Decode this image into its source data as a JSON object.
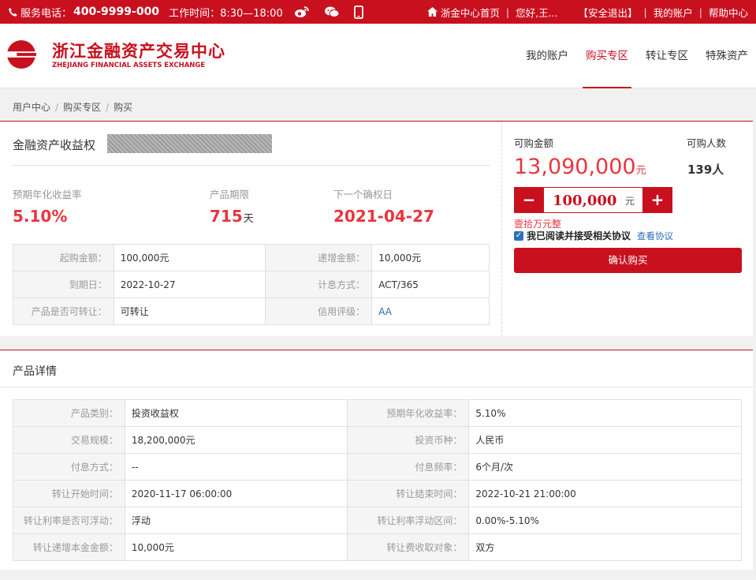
{
  "topbar": {
    "phone_label": "服务电话：",
    "phone_number": "400-9999-000",
    "hours": "工作时间：8:30—18:00",
    "home_link": "浙金中心首页",
    "greeting": "您好,王...",
    "logout": "【安全退出】",
    "my_account": "我的账户",
    "help": "帮助中心"
  },
  "header": {
    "logo_cn": "浙江金融资产交易中心",
    "logo_en": "ZHEJIANG FINANCIAL ASSETS EXCHANGE",
    "nav": [
      "我的账户",
      "购买专区",
      "转让专区",
      "特殊资产"
    ],
    "active_nav": "购买专区"
  },
  "breadcrumb": [
    "用户中心",
    "购买专区",
    "购买"
  ],
  "product": {
    "name": "金融资产收益权",
    "kpis": [
      {
        "label": "预期年化收益率",
        "value": "5.10%",
        "unit": ""
      },
      {
        "label": "产品期限",
        "value": "715",
        "unit": "天"
      },
      {
        "label": "下一个确权日",
        "value": "2021-04-27",
        "unit": ""
      }
    ],
    "info_rows": [
      [
        "起购金额：",
        "100,000元",
        "递增金额：",
        "10,000元"
      ],
      [
        "到期日：",
        "2022-10-27",
        "计息方式：",
        "ACT/365"
      ],
      [
        "产品是否可转让：",
        "可转让",
        "信用评级：",
        "AA"
      ]
    ]
  },
  "buy": {
    "amount_label": "可购金额",
    "amount_value": "13,090,000",
    "amount_unit": "元",
    "buyers_label": "可购人数",
    "buyers_value": "139人",
    "minus": "−",
    "plus": "+",
    "input_value": "100,000",
    "input_unit": "元",
    "amount_words": "壹拾万元整",
    "agree_text": "我已阅读并接受相关协议",
    "agree_checked": true,
    "view_agreement": "查看协议",
    "confirm": "确认购买"
  },
  "details": {
    "title": "产品详情",
    "rows": [
      [
        "产品类别：",
        "投资收益权",
        "预期年化收益率：",
        "5.10%"
      ],
      [
        "交易规模：",
        "18,200,000元",
        "投资币种：",
        "人民币"
      ],
      [
        "付息方式：",
        "--",
        "付息频率：",
        "6个月/次"
      ],
      [
        "转让开始时间：",
        "2020-11-17 06:00:00",
        "转让结束时间：",
        "2022-10-21 21:00:00"
      ],
      [
        "转让利率是否可浮动：",
        "浮动",
        "转让利率浮动区间：",
        "0.00%-5.10%"
      ],
      [
        "转让递增本金金额：",
        "10,000元",
        "转让费收取对象：",
        "双方"
      ]
    ]
  },
  "colors": {
    "brand": "#c8101f",
    "accent_red": "#e8353f",
    "link": "#2a6cb4"
  }
}
